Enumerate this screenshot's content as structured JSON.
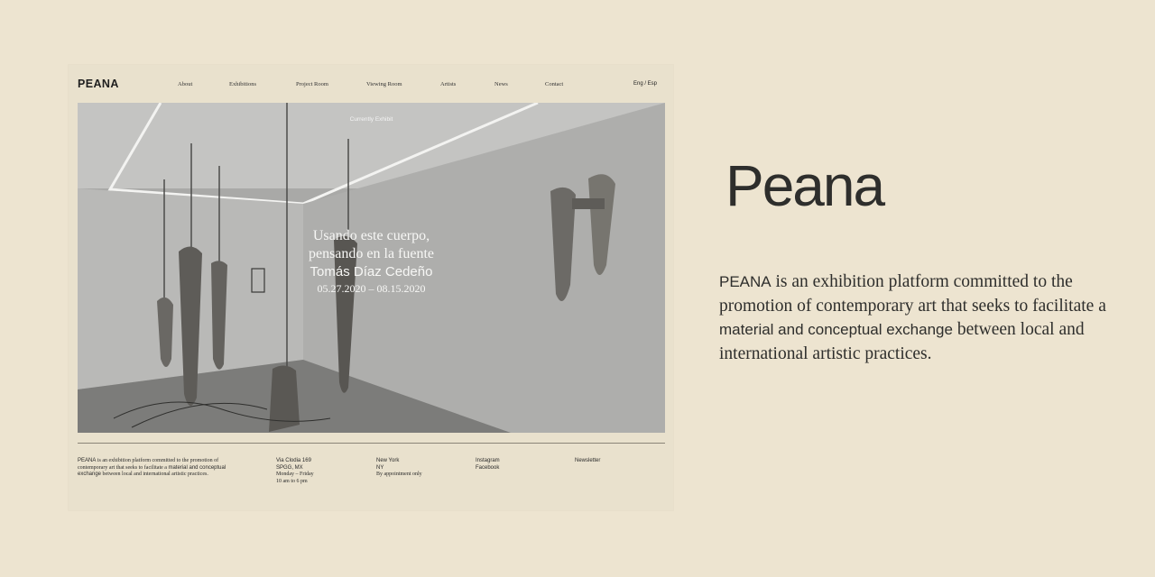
{
  "header": {
    "logo": "PEANA",
    "nav": [
      "About",
      "Exhibitions",
      "Project Room",
      "Viewing Room",
      "Artists",
      "News",
      "Contact"
    ],
    "language": "Eng / Esp"
  },
  "hero": {
    "label": "Currently Exhibit",
    "title": "Usando este cuerpo,\npensando en la fuente",
    "artist": "Tomás Díaz Cedeño",
    "dates": "05.27.2020 – 08.15.2020"
  },
  "footer": {
    "about_lead": "PEANA",
    "about_part1": " is an exhibition platform committed to the promotion of",
    "about_line2a": "contemporary art that seeks to facilitate a ",
    "about_emph1": "material and conceptual",
    "about_emph2": "exchange",
    "about_line3": " between local and international artistic practices.",
    "address": [
      "Via Clodia 169",
      "SPGG, MX",
      "Monday – Friday",
      "10 am to 6 pm"
    ],
    "newyork": [
      "New York",
      "NY",
      "By appointment only"
    ],
    "social": [
      "Instagram",
      "Facebook"
    ],
    "newsletter": "Newsletter"
  },
  "brand": {
    "title": "Peana",
    "desc_lead": "PEANA",
    "desc_part1": " is an exhibition platform committed to the promotion of contemporary art that seeks to facilitate a ",
    "desc_emph": "material and conceptual exchange",
    "desc_part2": " between local and international artistic practices."
  },
  "colors": {
    "background": "#ede4d0",
    "card": "#e9e1cd",
    "text": "#2e2e2c"
  }
}
